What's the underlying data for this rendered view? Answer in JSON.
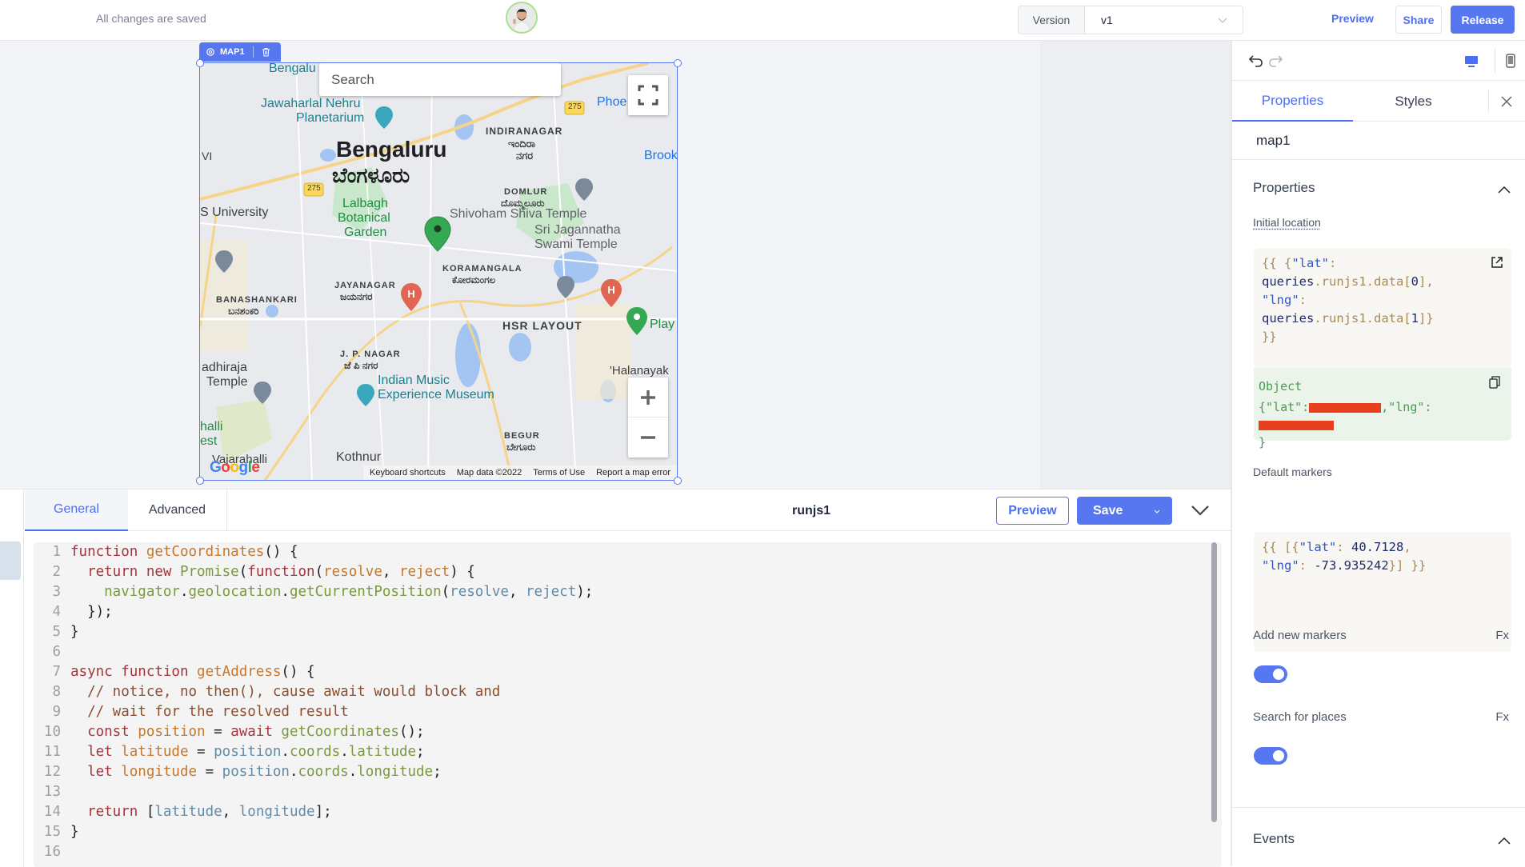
{
  "topbar": {
    "save_status": "All changes are saved",
    "version_label": "Version",
    "version_value": "v1",
    "preview_label": "Preview",
    "share_label": "Share",
    "release_label": "Release"
  },
  "widget": {
    "tag_label": "MAP1",
    "map": {
      "search_placeholder": "Search",
      "labels": {
        "bengaluru_top": "Bengalu",
        "planetarium_1": "Jawaharlal Nehru",
        "planetarium_2": "Planetarium",
        "phoenix": "Phoe",
        "indiranagar": "INDIRANAGAR",
        "indiranagar_kn": "ಇಂದಿರಾ",
        "indiranagar_kn2": "ನಗರ",
        "city_en": "Bengaluru",
        "city_kn": "ಬೆಂಗಳೂರು",
        "brook": "Brook",
        "vi": "VI",
        "route_275a": "275",
        "route_275b": "275",
        "domlur": "DOMLUR",
        "domlur_kn": "ದೊಮ್ಮಲೂರು",
        "university": "S University",
        "lalbagh_1": "Lalbagh",
        "lalbagh_2": "Botanical",
        "lalbagh_3": "Garden",
        "shivoham": "Shivoham Shiva Temple",
        "jagannatha_1": "Sri Jagannatha",
        "jagannatha_2": "Swami Temple",
        "koramangala": "KORAMANGALA",
        "koramangala_kn": "ಕೋರಮಂಗಲ",
        "jayanagar": "JAYANAGAR",
        "jayanagar_kn": "ಜಯನಗರ",
        "banashankari": "BANASHANKARI",
        "banashankari_kn": "ಬನಶಂಕರಿ",
        "hsr": "HSR LAYOUT",
        "play": "Play",
        "jp_nagar": "J. P. NAGAR",
        "jp_nagar_kn": "ಜೆ ಪಿ ನಗರ",
        "adhiraja_1": "adhiraja",
        "adhiraja_2": "Temple",
        "museum_1": "Indian Music",
        "museum_2": "Experience Museum",
        "halanayak": "'Halanayak",
        "halli": "halli",
        "est": "est",
        "begur": "BEGUR",
        "begur_kn": "ಬೇಗೂರು",
        "kothnur": "Kothnur",
        "vajarahalli": "Vajarahalli"
      },
      "footer": {
        "shortcuts": "Keyboard shortcuts",
        "map_data": "Map data ©2022",
        "terms": "Terms of Use",
        "report": "Report a map error"
      },
      "google_logo": "Google"
    }
  },
  "query_panel": {
    "tabs": [
      {
        "label": "General",
        "active": true
      },
      {
        "label": "Advanced",
        "active": false
      }
    ],
    "query_name": "runjs1",
    "preview_label": "Preview",
    "save_label": "Save",
    "code_lines": [
      "function getCoordinates() {",
      "  return new Promise(function(resolve, reject) {",
      "    navigator.geolocation.getCurrentPosition(resolve, reject);",
      "  });",
      "}",
      "",
      "async function getAddress() {",
      "  // notice, no then(), cause await would block and",
      "  // wait for the resolved result",
      "  const position = await getCoordinates();",
      "  let latitude = position.coords.latitude;",
      "  let longitude = position.coords.longitude;",
      "",
      "  return [latitude, longitude];",
      "}",
      ""
    ]
  },
  "right_panel": {
    "tabs": [
      {
        "label": "Properties",
        "active": true
      },
      {
        "label": "Styles",
        "active": false
      }
    ],
    "component_name": "map1",
    "properties_section": {
      "title": "Properties",
      "initial_location": {
        "label": "Initial location",
        "code_lines": [
          "{{ {\"lat\":",
          "queries.runjs1.data[0],",
          "\"lng\":",
          "queries.runjs1.data[1]}",
          "}}"
        ],
        "result_type": "Object",
        "result_prefix_lat": "{\"lat\":",
        "result_mid_lng": ",\"lng\":",
        "result_suffix": "}"
      },
      "default_markers": {
        "label": "Default markers",
        "code_lines": [
          "{{ [{\"lat\": 40.7128,",
          "\"lng\": -73.935242}] }}"
        ]
      },
      "add_new_markers": {
        "label": "Add new markers",
        "fx": "Fx",
        "enabled": true
      },
      "search_for_places": {
        "label": "Search for places",
        "fx": "Fx",
        "enabled": true
      }
    },
    "events_section": {
      "title": "Events"
    }
  }
}
